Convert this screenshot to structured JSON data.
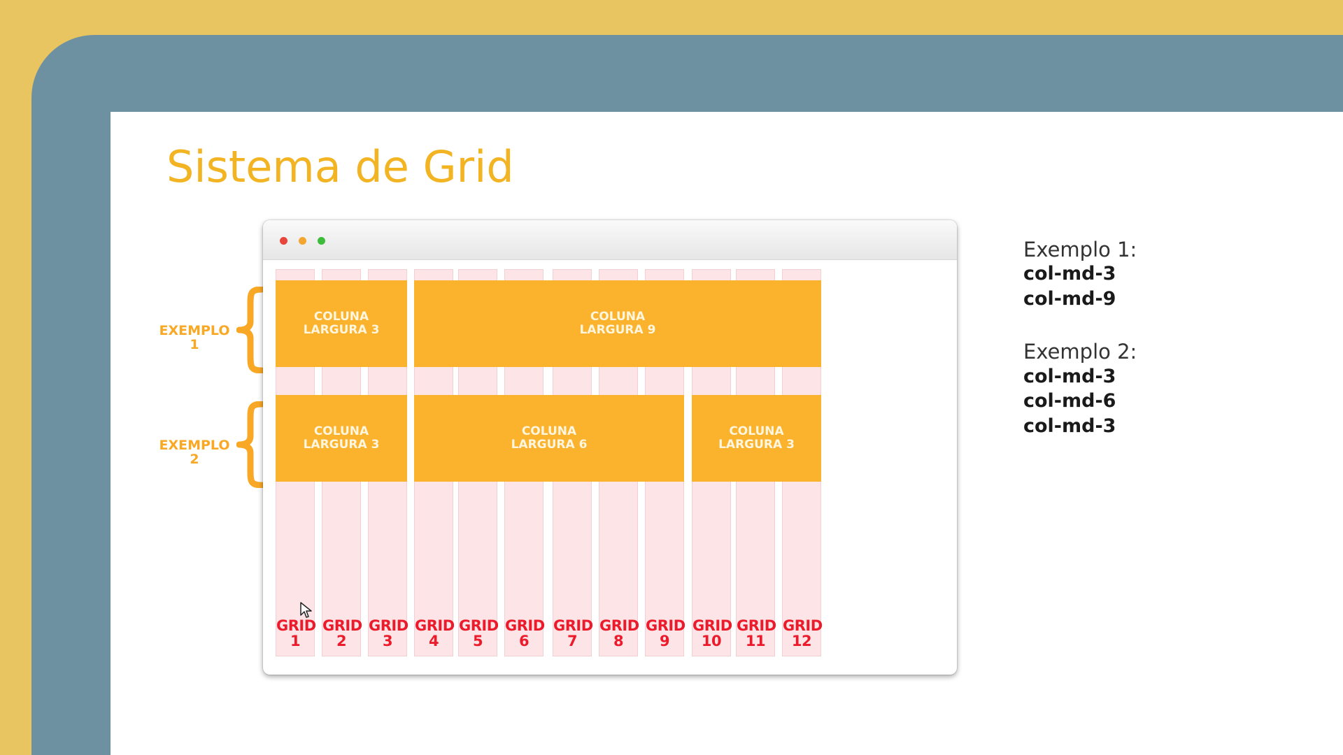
{
  "slide": {
    "title": "Sistema de Grid"
  },
  "colors": {
    "background": "#e8c560",
    "frame": "#6e91a1",
    "accent": "#f3b423",
    "column_block": "#fbb22c",
    "grid_column": "#fde5e7",
    "grid_label": "#ec1b2c"
  },
  "browser": {
    "dots": [
      "#e8463a",
      "#f3a630",
      "#3dbb3b"
    ]
  },
  "grid": {
    "columns": [
      {
        "label": "GRID",
        "number": "1"
      },
      {
        "label": "GRID",
        "number": "2"
      },
      {
        "label": "GRID",
        "number": "3"
      },
      {
        "label": "GRID",
        "number": "4"
      },
      {
        "label": "GRID",
        "number": "5"
      },
      {
        "label": "GRID",
        "number": "6"
      },
      {
        "label": "GRID",
        "number": "7"
      },
      {
        "label": "GRID",
        "number": "8"
      },
      {
        "label": "GRID",
        "number": "9"
      },
      {
        "label": "GRID",
        "number": "10"
      },
      {
        "label": "GRID",
        "number": "11"
      },
      {
        "label": "GRID",
        "number": "12"
      }
    ]
  },
  "examples": [
    {
      "label_line1": "EXEMPLO",
      "label_line2": "1",
      "blocks": [
        {
          "line1": "COLUNA",
          "line2": "LARGURA 3",
          "span": 3
        },
        {
          "line1": "COLUNA",
          "line2": "LARGURA 9",
          "span": 9
        }
      ]
    },
    {
      "label_line1": "EXEMPLO",
      "label_line2": "2",
      "blocks": [
        {
          "line1": "COLUNA",
          "line2": "LARGURA 3",
          "span": 3
        },
        {
          "line1": "COLUNA",
          "line2": "LARGURA 6",
          "span": 6
        },
        {
          "line1": "COLUNA",
          "line2": "LARGURA 3",
          "span": 3
        }
      ]
    }
  ],
  "notes": {
    "example1": {
      "heading": "Exemplo 1:",
      "items": [
        "col-md-3",
        "col-md-9"
      ]
    },
    "example2": {
      "heading": "Exemplo 2:",
      "items": [
        "col-md-3",
        "col-md-6",
        "col-md-3"
      ]
    }
  }
}
